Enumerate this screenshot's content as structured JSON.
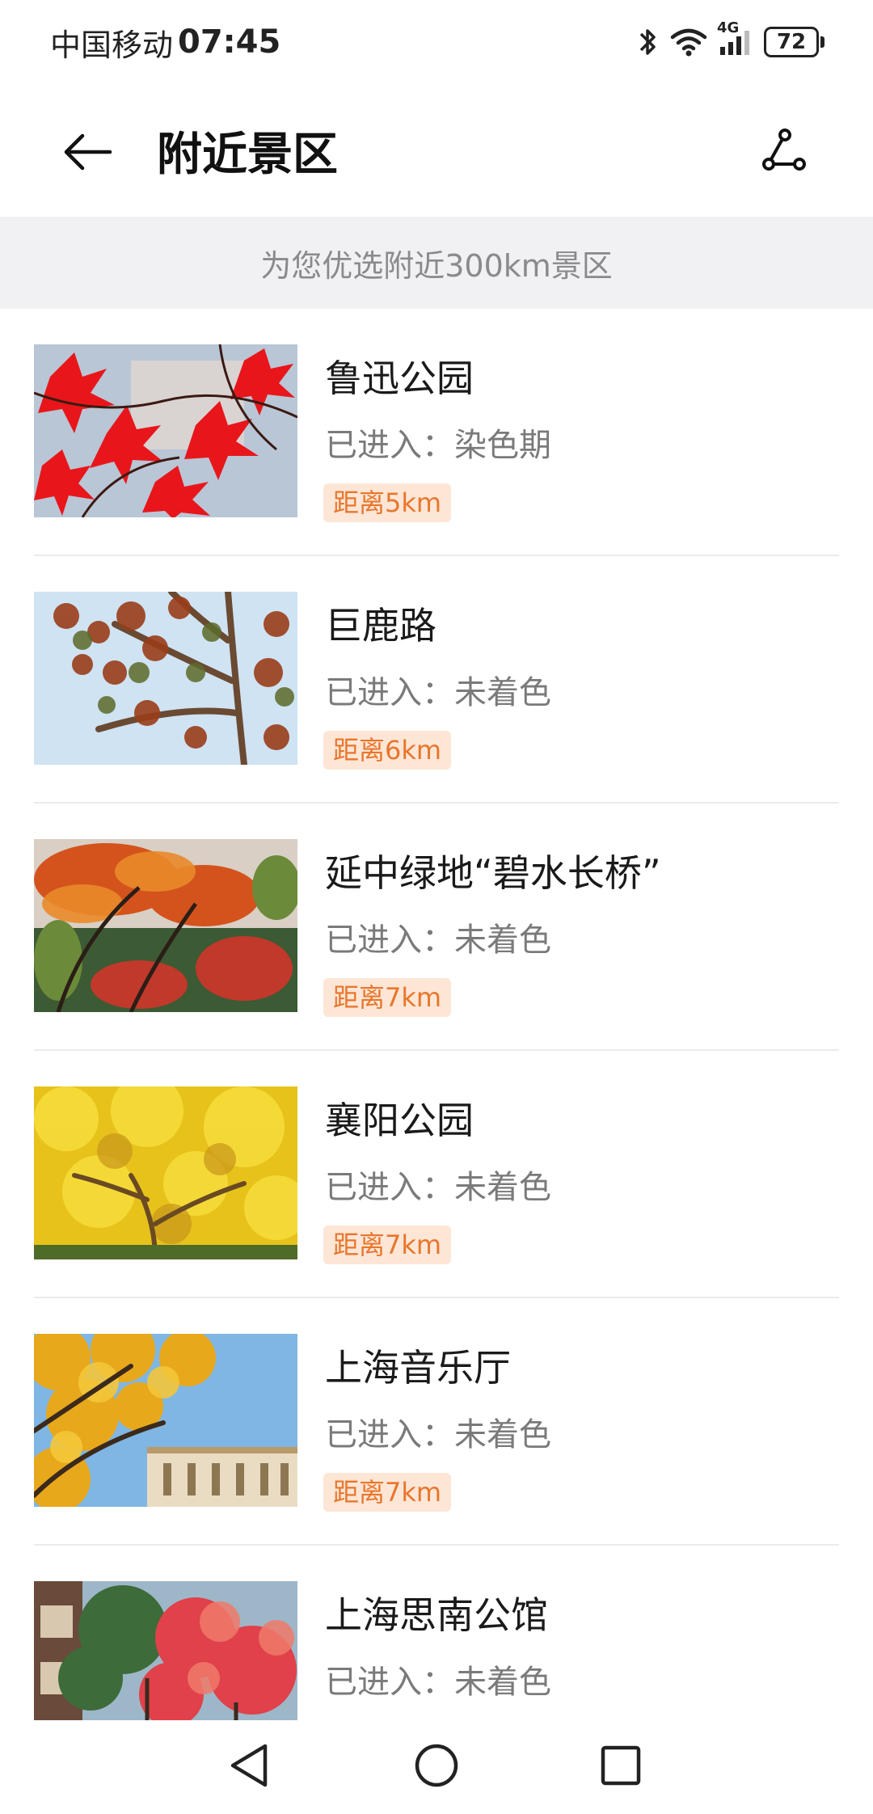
{
  "status_bar": {
    "carrier": "中国移动",
    "time": "07:45",
    "network": "4G",
    "battery": "72",
    "icons": [
      "bluetooth-icon",
      "wifi-icon",
      "signal-icon",
      "battery-icon"
    ]
  },
  "header": {
    "title": "附近景区",
    "back_icon": "arrow-left-icon",
    "route_icon": "route-icon"
  },
  "banner": {
    "text": "为您优选附近300km景区"
  },
  "colors": {
    "distance_text": "#e8762c",
    "distance_bg": "#fde6d6",
    "banner_bg": "#f1f1f3"
  },
  "spots": [
    {
      "name": "鲁迅公园",
      "stage": "已进入：染色期",
      "distance": "距离5km",
      "image": "red-maple-leaves"
    },
    {
      "name": "巨鹿路",
      "stage": "已进入：未着色",
      "distance": "距离6km",
      "image": "plane-tree-branches"
    },
    {
      "name": "延中绿地“碧水长桥”",
      "stage": "已进入：未着色",
      "distance": "距离7km",
      "image": "autumn-park-trees"
    },
    {
      "name": "襄阳公园",
      "stage": "已进入：未着色",
      "distance": "距离7km",
      "image": "yellow-ginkgo-tree"
    },
    {
      "name": "上海音乐厅",
      "stage": "已进入：未着色",
      "distance": "距离7km",
      "image": "ginkgo-and-building"
    },
    {
      "name": "上海思南公馆",
      "stage": "已进入：未着色",
      "distance": "",
      "image": "red-trees-villa"
    }
  ],
  "nav_bar": {
    "buttons": [
      "back-triangle-icon",
      "home-circle-icon",
      "recents-square-icon"
    ]
  }
}
